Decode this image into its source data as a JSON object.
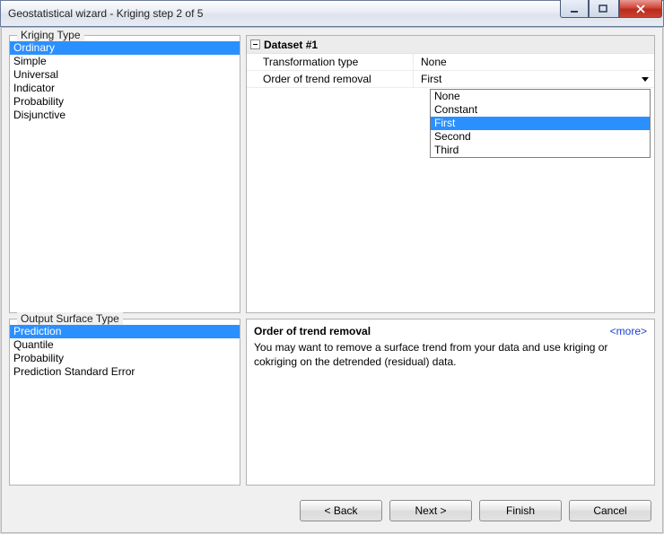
{
  "window": {
    "title": "Geostatistical wizard - Kriging step 2 of 5"
  },
  "kriging_type": {
    "label": "Kriging Type",
    "items": [
      "Ordinary",
      "Simple",
      "Universal",
      "Indicator",
      "Probability",
      "Disjunctive"
    ],
    "selected": 0
  },
  "output_surface": {
    "label": "Output Surface Type",
    "items": [
      "Prediction",
      "Quantile",
      "Probability",
      "Prediction Standard Error"
    ],
    "selected": 0
  },
  "dataset": {
    "title": "Dataset #1",
    "rows": [
      {
        "label": "Transformation type",
        "value": "None"
      },
      {
        "label": "Order of trend removal",
        "value": "First"
      }
    ]
  },
  "dropdown": {
    "items": [
      "None",
      "Constant",
      "First",
      "Second",
      "Third"
    ],
    "selected": 2
  },
  "help": {
    "title": "Order of trend removal",
    "more": "<more>",
    "text": "You may want to remove a surface trend from your data and use kriging or cokriging on the detrended (residual) data."
  },
  "buttons": {
    "back": "< Back",
    "next": "Next >",
    "finish": "Finish",
    "cancel": "Cancel"
  }
}
